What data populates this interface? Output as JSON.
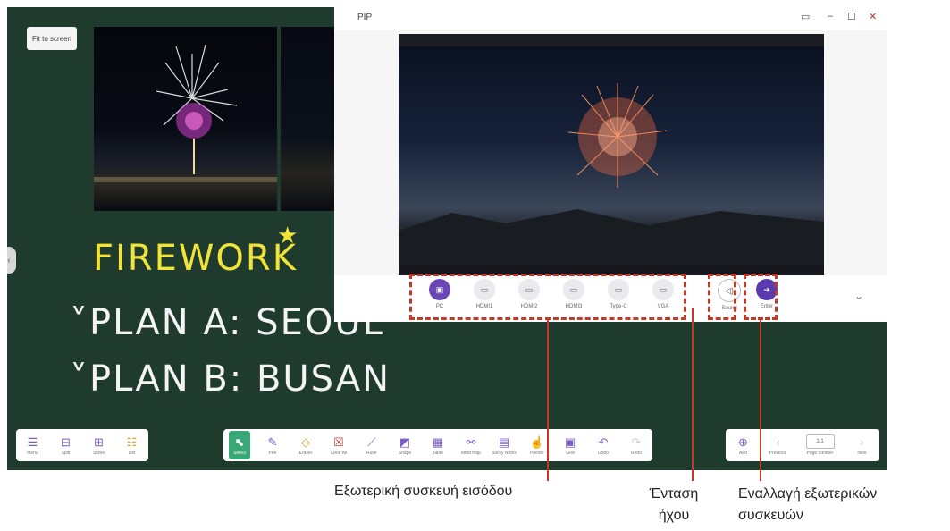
{
  "board": {
    "fit_button": "Fit to screen",
    "handwriting": {
      "line1": "FIREWORK",
      "line2": "˅PLAN A: SEOUL",
      "line3": "˅PLAN B: BUSAN"
    }
  },
  "pip": {
    "title": "PIP",
    "sources": [
      {
        "label": "PC",
        "icon": "monitor-icon"
      },
      {
        "label": "HDMI1",
        "icon": "hdmi-icon"
      },
      {
        "label": "HDMI2",
        "icon": "hdmi-icon"
      },
      {
        "label": "HDMI3",
        "icon": "hdmi-icon"
      },
      {
        "label": "Type-C",
        "icon": "usb-c-icon"
      },
      {
        "label": "VGA",
        "icon": "vga-icon"
      }
    ],
    "sound_label": "Sound",
    "enter_label": "Enter"
  },
  "toolbar_left": [
    {
      "label": "Menu",
      "icon": "menu-icon"
    },
    {
      "label": "Split",
      "icon": "split-icon"
    },
    {
      "label": "Share",
      "icon": "share-icon"
    },
    {
      "label": "List",
      "icon": "list-icon"
    }
  ],
  "toolbar_center": [
    {
      "label": "Select",
      "icon": "cursor-icon"
    },
    {
      "label": "Pen",
      "icon": "pen-icon"
    },
    {
      "label": "Eraser",
      "icon": "eraser-icon"
    },
    {
      "label": "Clear All",
      "icon": "clear-all-icon"
    },
    {
      "label": "Ruler",
      "icon": "ruler-icon"
    },
    {
      "label": "Shape",
      "icon": "shape-icon"
    },
    {
      "label": "Table",
      "icon": "table-icon"
    },
    {
      "label": "Mind map",
      "icon": "mind-map-icon"
    },
    {
      "label": "Sticky Notes",
      "icon": "sticky-notes-icon"
    },
    {
      "label": "Pointer",
      "icon": "pointer-icon"
    },
    {
      "label": "Grid",
      "icon": "grid-icon"
    },
    {
      "label": "Undo",
      "icon": "undo-icon"
    },
    {
      "label": "Redo",
      "icon": "redo-icon"
    }
  ],
  "toolbar_right": {
    "add_label": "Add",
    "previous_label": "Previous",
    "page_number": "1/1",
    "page_number_label": "Page number",
    "next_label": "Next"
  },
  "captions": {
    "external_input": "Εξωτερική συσκευή εισόδου",
    "volume": "Ένταση\nήχου",
    "switch_devices": "Εναλλαγή εξωτερικών\nσυσκευών"
  },
  "colors": {
    "board": "#1f3b2e",
    "accent": "#6a46b6",
    "annotation": "#c0392b",
    "select": "#3aa876"
  }
}
